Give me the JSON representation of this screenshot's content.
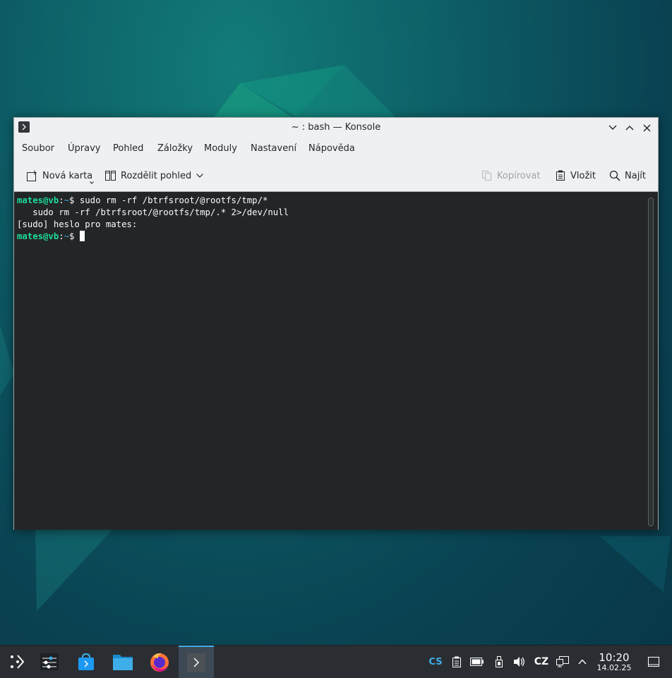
{
  "window": {
    "title": "~ : bash — Konsole"
  },
  "menu": [
    "Soubor",
    "Úpravy",
    "Pohled",
    "Záložky",
    "Moduly",
    "Nastavení",
    "Nápověda"
  ],
  "toolbar": {
    "new_tab": "Nová karta",
    "split_view": "Rozdělit pohled",
    "copy": "Kopírovat",
    "paste": "Vložit",
    "find": "Najít"
  },
  "terminal": {
    "prompt_user": "mates@vb",
    "prompt_path": "~",
    "line1_cmd": " sudo rm -rf /btrfsroot/@rootfs/tmp/*",
    "line2": "   sudo rm -rf /btrfsroot/@rootfs/tmp/.* 2>/dev/null",
    "line3": "[sudo] heslo pro mates:"
  },
  "tray": {
    "input_method": "CS",
    "keyboard_layout": "CZ",
    "time": "10:20",
    "date": "14.02.25"
  },
  "colors": {
    "prompt_green": "#1cdc9a",
    "terminal_bg": "#232627",
    "taskbar_bg": "#2a2e32",
    "active_accent": "#3daee9",
    "input_method_blue": "#3daee9"
  },
  "icons": {
    "taskbar": [
      "application-launcher-icon",
      "system-settings-icon",
      "discover-store-icon",
      "dolphin-folder-icon",
      "firefox-icon",
      "konsole-icon"
    ],
    "tray": [
      "clipboard-icon",
      "battery-icon",
      "usb-device-icon",
      "volume-icon",
      "network-icon",
      "expand-tray-icon",
      "show-desktop-icon"
    ]
  }
}
